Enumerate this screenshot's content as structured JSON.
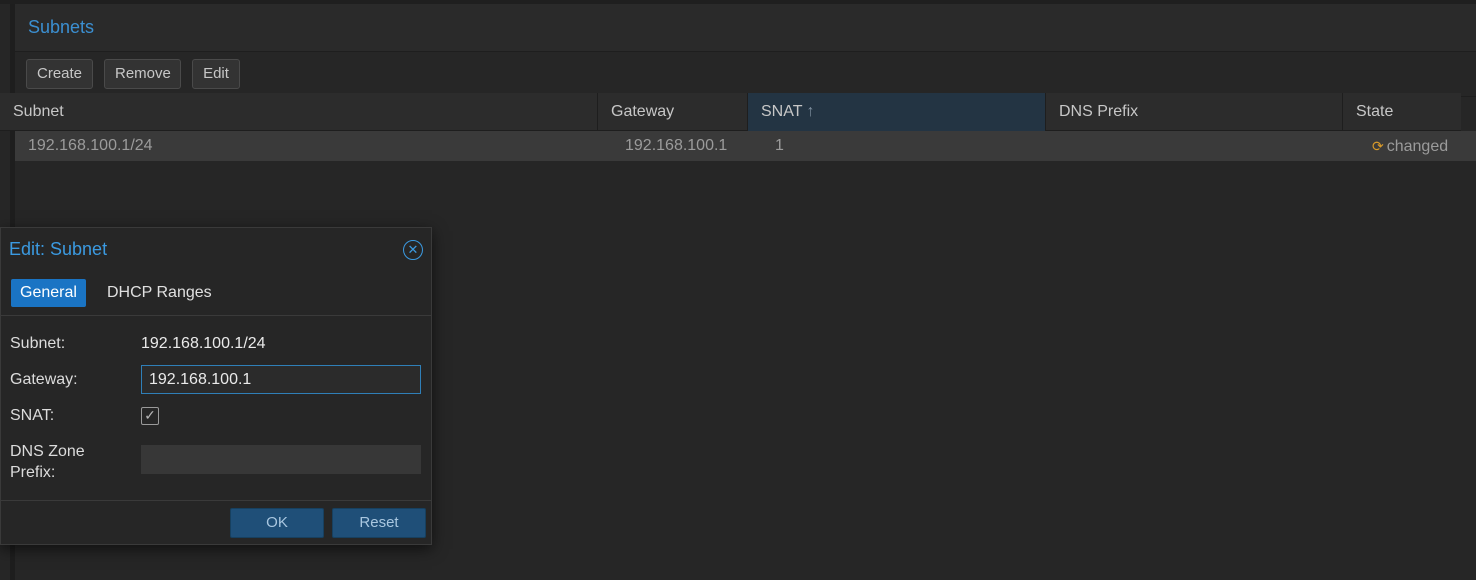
{
  "panel": {
    "title": "Subnets"
  },
  "toolbar": {
    "create_label": "Create",
    "remove_label": "Remove",
    "edit_label": "Edit"
  },
  "grid": {
    "columns": [
      "Subnet",
      "Gateway",
      "SNAT",
      "DNS Prefix",
      "State"
    ],
    "sorted_column": "SNAT",
    "sort_direction": "ascending",
    "rows": [
      {
        "subnet": "192.168.100.1/24",
        "gateway": "192.168.100.1",
        "snat": "1",
        "dns_prefix": "",
        "state": "changed",
        "state_icon": "refresh-icon"
      }
    ]
  },
  "dialog": {
    "title": "Edit: Subnet",
    "tabs": [
      "General",
      "DHCP Ranges"
    ],
    "active_tab": "General",
    "fields": {
      "subnet_label": "Subnet:",
      "subnet_value": "192.168.100.1/24",
      "gateway_label": "Gateway:",
      "gateway_value": "192.168.100.1",
      "snat_label": "SNAT:",
      "snat_checked": true,
      "dns_label_1": "DNS Zone",
      "dns_label_2": "Prefix:",
      "dns_value": ""
    },
    "ok_label": "OK",
    "reset_label": "Reset"
  },
  "colors": {
    "accent": "#3b9ae1",
    "active_tab": "#1a74c4",
    "state_icon": "#d89a2a"
  }
}
